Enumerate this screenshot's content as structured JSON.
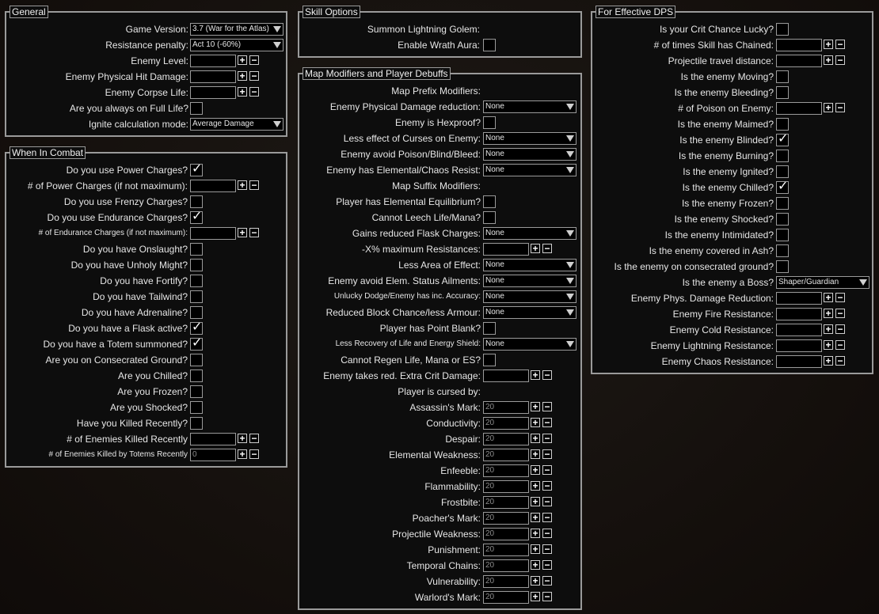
{
  "general": {
    "title": "General",
    "game_version_label": "Game Version:",
    "game_version_value": "3.7 (War for the Atlas)",
    "resistance_penalty_label": "Resistance penalty:",
    "resistance_penalty_value": "Act 10 (-60%)",
    "enemy_level_label": "Enemy Level:",
    "enemy_phys_hit_label": "Enemy Physical Hit Damage:",
    "enemy_corpse_life_label": "Enemy Corpse Life:",
    "full_life_label": "Are you always on Full Life?",
    "ignite_mode_label": "Ignite calculation mode:",
    "ignite_mode_value": "Average Damage"
  },
  "combat": {
    "title": "When In Combat",
    "rows": [
      {
        "label": "Do you use Power Charges?",
        "type": "check",
        "checked": true
      },
      {
        "label": "# of Power Charges (if not maximum):",
        "type": "num",
        "value": ""
      },
      {
        "label": "Do you use Frenzy Charges?",
        "type": "check",
        "checked": false
      },
      {
        "label": "Do you use Endurance Charges?",
        "type": "check",
        "checked": true
      },
      {
        "label": "# of Endurance Charges (if not maximum):",
        "type": "num",
        "value": "",
        "small": true
      },
      {
        "label": "Do you have Onslaught?",
        "type": "check",
        "checked": false
      },
      {
        "label": "Do you have Unholy Might?",
        "type": "check",
        "checked": false
      },
      {
        "label": "Do you have Fortify?",
        "type": "check",
        "checked": false
      },
      {
        "label": "Do you have Tailwind?",
        "type": "check",
        "checked": false
      },
      {
        "label": "Do you have Adrenaline?",
        "type": "check",
        "checked": false
      },
      {
        "label": "Do you have a Flask active?",
        "type": "check",
        "checked": true
      },
      {
        "label": "Do you have a Totem summoned?",
        "type": "check",
        "checked": true
      },
      {
        "label": "Are you on Consecrated Ground?",
        "type": "check",
        "checked": false
      },
      {
        "label": "Are you Chilled?",
        "type": "check",
        "checked": false
      },
      {
        "label": "Are you Frozen?",
        "type": "check",
        "checked": false
      },
      {
        "label": "Are you Shocked?",
        "type": "check",
        "checked": false
      },
      {
        "label": "Have you Killed Recently?",
        "type": "check",
        "checked": false
      },
      {
        "label": "# of Enemies Killed Recently",
        "type": "num",
        "value": ""
      },
      {
        "label": "# of Enemies Killed by Totems Recently",
        "type": "num",
        "value": "0",
        "small": true
      }
    ]
  },
  "skill": {
    "title": "Skill Options",
    "summon_golem_label": "Summon Lightning Golem:",
    "wrath_label": "Enable Wrath Aura:"
  },
  "map": {
    "title": "Map Modifiers and Player Debuffs",
    "rows": [
      {
        "label": "Map Prefix Modifiers:",
        "type": "header"
      },
      {
        "label": "Enemy Physical Damage reduction:",
        "type": "drop",
        "value": "None"
      },
      {
        "label": "Enemy is Hexproof?",
        "type": "check",
        "checked": false
      },
      {
        "label": "Less effect of Curses on Enemy:",
        "type": "drop",
        "value": "None"
      },
      {
        "label": "Enemy avoid Poison/Blind/Bleed:",
        "type": "drop",
        "value": "None"
      },
      {
        "label": "Enemy has Elemental/Chaos Resist:",
        "type": "drop",
        "value": "None"
      },
      {
        "label": "Map Suffix Modifiers:",
        "type": "header"
      },
      {
        "label": "Player has Elemental Equilibrium?",
        "type": "check",
        "checked": false
      },
      {
        "label": "Cannot Leech Life/Mana?",
        "type": "check",
        "checked": false
      },
      {
        "label": "Gains reduced Flask Charges:",
        "type": "drop",
        "value": "None"
      },
      {
        "label": "-X% maximum Resistances:",
        "type": "num",
        "value": ""
      },
      {
        "label": "Less Area of Effect:",
        "type": "drop",
        "value": "None"
      },
      {
        "label": "Enemy avoid Elem. Status Ailments:",
        "type": "drop",
        "value": "None"
      },
      {
        "label": "Unlucky Dodge/Enemy has inc. Accuracy:",
        "type": "drop",
        "value": "None",
        "small": true
      },
      {
        "label": "Reduced Block Chance/less Armour:",
        "type": "drop",
        "value": "None"
      },
      {
        "label": "Player has Point Blank?",
        "type": "check",
        "checked": false
      },
      {
        "label": "Less Recovery of Life and Energy Shield:",
        "type": "drop",
        "value": "None",
        "small": true
      },
      {
        "label": "Cannot Regen Life, Mana or ES?",
        "type": "check",
        "checked": false
      },
      {
        "label": "Enemy takes red. Extra Crit Damage:",
        "type": "num",
        "value": ""
      },
      {
        "label": "Player is cursed by:",
        "type": "header"
      },
      {
        "label": "Assassin's Mark:",
        "type": "num",
        "value": "20"
      },
      {
        "label": "Conductivity:",
        "type": "num",
        "value": "20"
      },
      {
        "label": "Despair:",
        "type": "num",
        "value": "20"
      },
      {
        "label": "Elemental Weakness:",
        "type": "num",
        "value": "20"
      },
      {
        "label": "Enfeeble:",
        "type": "num",
        "value": "20"
      },
      {
        "label": "Flammability:",
        "type": "num",
        "value": "20"
      },
      {
        "label": "Frostbite:",
        "type": "num",
        "value": "20"
      },
      {
        "label": "Poacher's Mark:",
        "type": "num",
        "value": "20"
      },
      {
        "label": "Projectile Weakness:",
        "type": "num",
        "value": "20"
      },
      {
        "label": "Punishment:",
        "type": "num",
        "value": "20"
      },
      {
        "label": "Temporal Chains:",
        "type": "num",
        "value": "20"
      },
      {
        "label": "Vulnerability:",
        "type": "num",
        "value": "20"
      },
      {
        "label": "Warlord's Mark:",
        "type": "num",
        "value": "20"
      }
    ]
  },
  "dps": {
    "title": "For Effective DPS",
    "rows": [
      {
        "label": "Is your Crit Chance Lucky?",
        "type": "check",
        "checked": false
      },
      {
        "label": "# of times Skill has Chained:",
        "type": "num",
        "value": ""
      },
      {
        "label": "Projectile travel distance:",
        "type": "num",
        "value": ""
      },
      {
        "label": "Is the enemy Moving?",
        "type": "check",
        "checked": false
      },
      {
        "label": "Is the enemy Bleeding?",
        "type": "check",
        "checked": false
      },
      {
        "label": "# of Poison on Enemy:",
        "type": "num",
        "value": ""
      },
      {
        "label": "Is the enemy Maimed?",
        "type": "check",
        "checked": false
      },
      {
        "label": "Is the enemy Blinded?",
        "type": "check",
        "checked": true
      },
      {
        "label": "Is the enemy Burning?",
        "type": "check",
        "checked": false
      },
      {
        "label": "Is the enemy Ignited?",
        "type": "check",
        "checked": false
      },
      {
        "label": "Is the enemy Chilled?",
        "type": "check",
        "checked": true
      },
      {
        "label": "Is the enemy Frozen?",
        "type": "check",
        "checked": false
      },
      {
        "label": "Is the enemy Shocked?",
        "type": "check",
        "checked": false
      },
      {
        "label": "Is the enemy Intimidated?",
        "type": "check",
        "checked": false
      },
      {
        "label": "Is the enemy covered in Ash?",
        "type": "check",
        "checked": false
      },
      {
        "label": "Is the enemy on consecrated ground?",
        "type": "check",
        "checked": false
      },
      {
        "label": "Is the enemy a Boss?",
        "type": "drop",
        "value": "Shaper/Guardian"
      },
      {
        "label": "Enemy Phys. Damage Reduction:",
        "type": "num",
        "value": ""
      },
      {
        "label": "Enemy Fire Resistance:",
        "type": "num",
        "value": ""
      },
      {
        "label": "Enemy Cold Resistance:",
        "type": "num",
        "value": ""
      },
      {
        "label": "Enemy Lightning Resistance:",
        "type": "num",
        "value": ""
      },
      {
        "label": "Enemy Chaos Resistance:",
        "type": "num",
        "value": ""
      }
    ]
  },
  "icons": {
    "check": "✓",
    "plus": "+",
    "minus": "−"
  }
}
